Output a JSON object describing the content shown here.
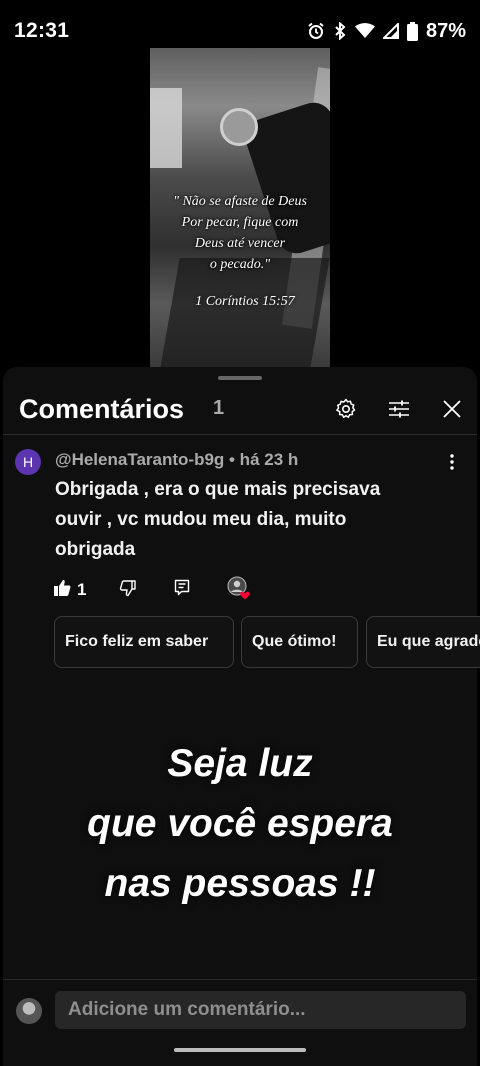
{
  "status_bar": {
    "time": "12:31",
    "battery": "87%",
    "icons": [
      "alarm-icon",
      "bluetooth-icon",
      "wifi-icon",
      "signal-icon",
      "battery-icon"
    ]
  },
  "video": {
    "quote": "\" Não se afaste de Deus\nPor  pecar, fique com\nDeus  até vencer\no  pecado.\"",
    "reference": "1 Coríntios 15:57"
  },
  "comments_panel": {
    "title": "Comentários",
    "count": "1",
    "header_icons": [
      "settings-icon",
      "filter-icon",
      "close-icon"
    ]
  },
  "comment": {
    "avatar_letter": "H",
    "author_meta": "@HelenaTaranto-b9g • há 23 h",
    "text": "Obrigada , era o que mais precisava ouvir , vc mudou meu dia, muito obrigada",
    "like_count": "1"
  },
  "reply_chips": [
    "Fico feliz em saber",
    "Que ótimo!",
    "Eu que agradeço"
  ],
  "overlay_text": "Seja luz\nque você espera\nnas pessoas !!",
  "composer": {
    "placeholder": "Adicione um comentário..."
  },
  "colors": {
    "sheet_bg": "#0f0f0f",
    "avatar_bg": "#5e35b1",
    "heart": "#ff0033"
  }
}
